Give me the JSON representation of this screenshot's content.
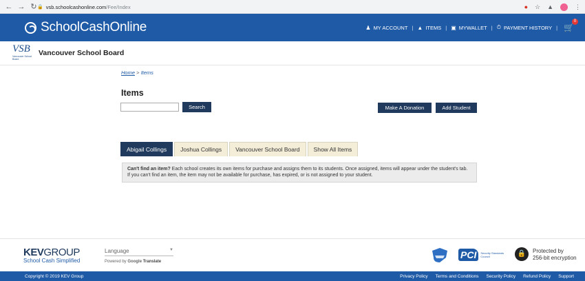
{
  "browser": {
    "url_domain": "vsb.schoolcashonline.com",
    "url_path": "/Fee/Index"
  },
  "header": {
    "brand": "SchoolCashOnline",
    "nav": [
      {
        "label": "MY ACCOUNT",
        "icon": "user-icon"
      },
      {
        "label": "ITEMS",
        "icon": "shopping-bag-icon"
      },
      {
        "label": "MYWALLET",
        "icon": "wallet-icon"
      },
      {
        "label": "PAYMENT HISTORY",
        "icon": "history-icon"
      }
    ],
    "cart_count": "0"
  },
  "board": {
    "logo_mark": "VSB",
    "logo_small": "Vancouver School Board",
    "name": "Vancouver School Board"
  },
  "breadcrumb": {
    "home": "Home",
    "separator": ">",
    "current": "Items"
  },
  "main": {
    "title": "Items",
    "search_value": "",
    "search_button": "Search",
    "donate_button": "Make A Donation",
    "add_student_button": "Add Student",
    "tabs": [
      {
        "label": "Abigail Collings",
        "active": true
      },
      {
        "label": "Joshua Collings",
        "active": false
      },
      {
        "label": "Vancouver School Board",
        "active": false
      },
      {
        "label": "Show All Items",
        "active": false
      }
    ],
    "info_strong": "Can't find an item?",
    "info_text": " Each school creates its own items for purchase and assigns them to its students. Once assigned, items will appear under the student's tab. If you can't find an item, the item may not be available for purchase, has expired, or is not assigned to your student."
  },
  "footer": {
    "kev_bold": "KEV",
    "kev_thin": "GROUP",
    "kev_sub": "School Cash Simplified",
    "language_label": "Language",
    "powered_by": "Powered by",
    "google": "Google",
    "translate": "Translate",
    "pci_mark": "PCI",
    "pci_sub": "Security Standards Council",
    "protected_line1": "Protected by",
    "protected_line2": "256-bit encryption",
    "copyright": "Copyright © 2019 KEV Group",
    "links": [
      "Privacy Policy",
      "Terms and Conditions",
      "Security Policy",
      "Refund Policy",
      "Support"
    ]
  },
  "colors": {
    "header_blue": "#1f5aa6",
    "button_navy": "#1f3a5c",
    "tab_bg": "#f4eed9",
    "badge_red": "#e53935"
  }
}
